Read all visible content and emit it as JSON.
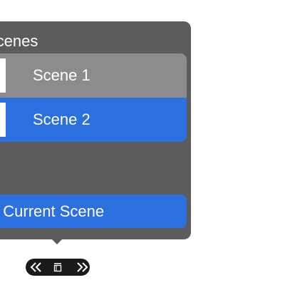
{
  "popover": {
    "title": "Scenes",
    "scenes": [
      {
        "label": "Scene 1",
        "state": "normal"
      },
      {
        "label": "Scene 2",
        "state": "selected"
      }
    ],
    "save_label": "Save Current Scene"
  },
  "toolbar": {
    "icons": [
      "double-chevron-left-icon",
      "presentation-icon",
      "double-chevron-right-icon"
    ]
  },
  "colors": {
    "panel": "#5c5c5c",
    "row_normal": "#8c8c8c",
    "accent": "#2c70e0",
    "toolbar": "#1a1a1a"
  }
}
